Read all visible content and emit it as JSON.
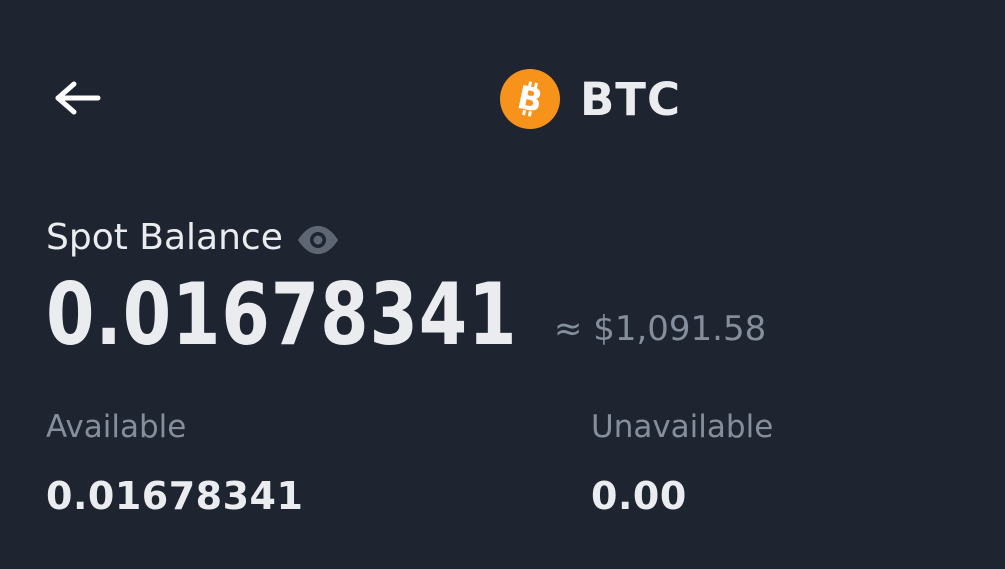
{
  "header": {
    "title": "BTC",
    "back_icon": "arrow-left-icon",
    "coin_icon": "bitcoin-icon",
    "coin_color": "#f7931a"
  },
  "balance": {
    "label": "Spot Balance",
    "visibility_icon": "eye-icon",
    "amount": "0.01678341",
    "fiat_value": "≈ $1,091.58"
  },
  "details": {
    "available_label": "Available",
    "available_value": "0.01678341",
    "unavailable_label": "Unavailable",
    "unavailable_value": "0.00"
  },
  "colors": {
    "background": "#1f2530",
    "primary_text": "#eaecef",
    "secondary_text": "#848e9c"
  }
}
